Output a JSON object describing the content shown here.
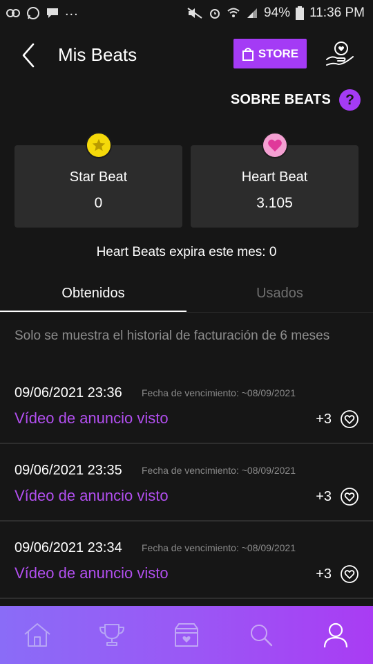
{
  "status_bar": {
    "more": "...",
    "battery": "94%",
    "time": "11:36 PM"
  },
  "header": {
    "title": "Mis Beats",
    "store_label": "STORE"
  },
  "about": {
    "label": "SOBRE BEATS",
    "help_symbol": "?"
  },
  "cards": [
    {
      "name": "Star Beat",
      "value": "0",
      "icon": "star-icon",
      "color": "#f5d90a"
    },
    {
      "name": "Heart Beat",
      "value": "3.105",
      "icon": "heart-icon",
      "color": "#f4a0d2"
    }
  ],
  "expire_text": "Heart Beats expira este mes: 0",
  "tabs": [
    {
      "label": "Obtenidos",
      "active": true
    },
    {
      "label": "Usados",
      "active": false
    }
  ],
  "notice": "Solo se muestra el historial de facturación de 6 meses",
  "history": [
    {
      "date": "09/06/2021 23:36",
      "expiry": "Fecha de vencimiento: ~08/09/2021",
      "title": "Vídeo de anuncio visto",
      "amount": "+3"
    },
    {
      "date": "09/06/2021 23:35",
      "expiry": "Fecha de vencimiento: ~08/09/2021",
      "title": "Vídeo de anuncio visto",
      "amount": "+3"
    },
    {
      "date": "09/06/2021 23:34",
      "expiry": "Fecha de vencimiento: ~08/09/2021",
      "title": "Vídeo de anuncio visto",
      "amount": "+3"
    }
  ],
  "bottom_nav": [
    {
      "icon": "home-icon",
      "active": false
    },
    {
      "icon": "trophy-icon",
      "active": false
    },
    {
      "icon": "store-box-icon",
      "active": false
    },
    {
      "icon": "search-icon",
      "active": false
    },
    {
      "icon": "profile-icon",
      "active": true
    }
  ],
  "colors": {
    "accent": "#a43bf5",
    "link_purple": "#b24ff0",
    "background": "#161616",
    "card": "#2c2c2c"
  }
}
